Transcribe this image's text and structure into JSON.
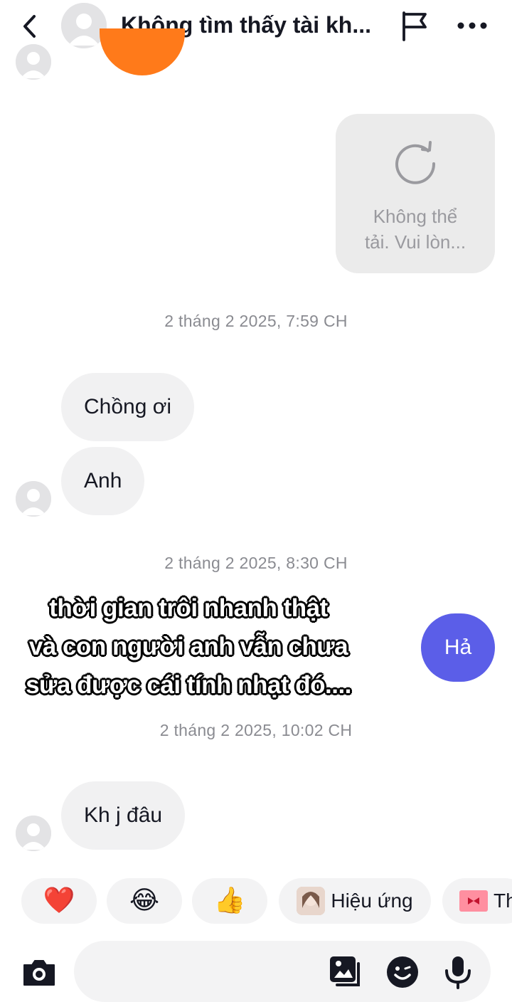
{
  "header": {
    "title": "Không tìm thấy tài kh...",
    "back_icon": "chevron-left-icon",
    "flag_icon": "flag-icon",
    "more_icon": "more-dots-icon"
  },
  "messages": {
    "failed_media": {
      "icon": "reload-icon",
      "text_line1": "Không thể",
      "text_line2": "tải. Vui lòn..."
    },
    "timestamp_1": "2 tháng 2 2025, 7:59 CH",
    "msg_1": "Chồng ơi",
    "msg_2": "Anh",
    "timestamp_2": "2 tháng 2 2025, 8:30 CH",
    "msg_out": "Hả",
    "timestamp_3": "2 tháng 2 2025, 10:02 CH",
    "msg_3": "Kh j đâu"
  },
  "overlay_caption": {
    "line1": "thời gian trôi nhanh thật",
    "line2": "và con người anh vẫn chưa",
    "line3": "sửa được cái tính nhạt đó...."
  },
  "quick_reactions": {
    "heart": "❤️",
    "laugh": "😂",
    "thumbs_up": "👍",
    "effect_label": "Hiệu ứng",
    "gift_label": "Th"
  },
  "composer": {
    "placeholder": "",
    "camera_icon": "camera-icon",
    "gallery_icon": "image-gallery-icon",
    "emoji_icon": "emoji-icon",
    "mic_icon": "microphone-icon"
  },
  "colors": {
    "outgoing_bubble": "#5b5ee8",
    "incoming_bubble": "#f1f1f2",
    "timestamp": "#8a8b91"
  }
}
